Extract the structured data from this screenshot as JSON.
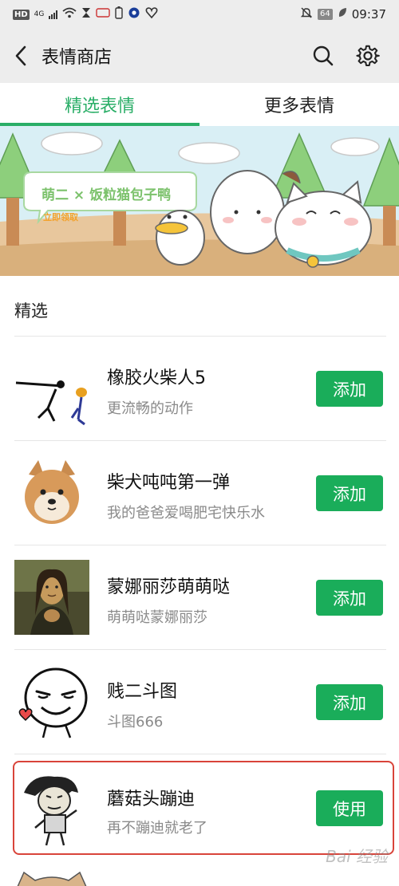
{
  "status_bar": {
    "left_items": [
      "HD",
      "4G"
    ],
    "right_badge": "64",
    "time": "09:37"
  },
  "nav": {
    "title": "表情商店"
  },
  "tabs": [
    {
      "label": "精选表情",
      "active": true
    },
    {
      "label": "更多表情",
      "active": false
    }
  ],
  "banner": {
    "headline": "萌二 × 饭粒猫包子鸭",
    "cta": "立即领取"
  },
  "section": {
    "title": "精选"
  },
  "items": [
    {
      "title": "橡胶火柴人5",
      "subtitle": "更流畅的动作",
      "button": "添加",
      "icon": "stickman-icon"
    },
    {
      "title": "柴犬吨吨第一弹",
      "subtitle": "我的爸爸爱喝肥宅快乐水",
      "button": "添加",
      "icon": "shiba-dog-icon"
    },
    {
      "title": "蒙娜丽莎萌萌哒",
      "subtitle": "萌萌哒蒙娜丽莎",
      "button": "添加",
      "icon": "mona-lisa-icon"
    },
    {
      "title": "贱二斗图",
      "subtitle": "斗图666",
      "button": "添加",
      "icon": "smirk-face-icon"
    },
    {
      "title": "蘑菇头蹦迪",
      "subtitle": "再不蹦迪就老了",
      "button": "使用",
      "icon": "mushroom-head-icon"
    }
  ],
  "watermark": "Bai 经验",
  "colors": {
    "accent": "#2aae67",
    "button": "#1aad5a",
    "highlight_border": "#d9443a"
  }
}
